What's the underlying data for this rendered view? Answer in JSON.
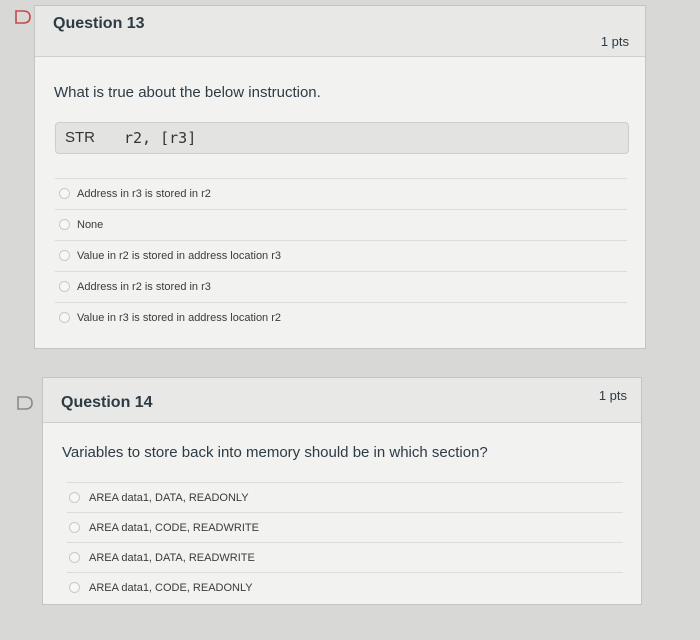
{
  "questions": [
    {
      "title": "Question 13",
      "points": "1 pts",
      "prompt": "What is true about the below instruction.",
      "code": {
        "op": "STR",
        "args": "r2, [r3]"
      },
      "answers": [
        "Address in r3 is stored in r2",
        "None",
        "Value in r2 is stored in address location r3",
        "Address in r2 is stored in r3",
        "Value in r3 is stored in address location r2"
      ]
    },
    {
      "title": "Question 14",
      "points": "1 pts",
      "prompt": "Variables to store back into memory should be in which section?",
      "answers": [
        "AREA data1, DATA, READONLY",
        "AREA data1, CODE, READWRITE",
        "AREA data1, DATA, READWRITE",
        "AREA data1, CODE, READONLY"
      ]
    }
  ],
  "colors": {
    "flag": "#c44a4a",
    "page_bg": "#d8d8d6",
    "card_bg": "#f2f2f0"
  },
  "icons": {
    "flag": "flag-icon",
    "radio": "radio-button"
  }
}
